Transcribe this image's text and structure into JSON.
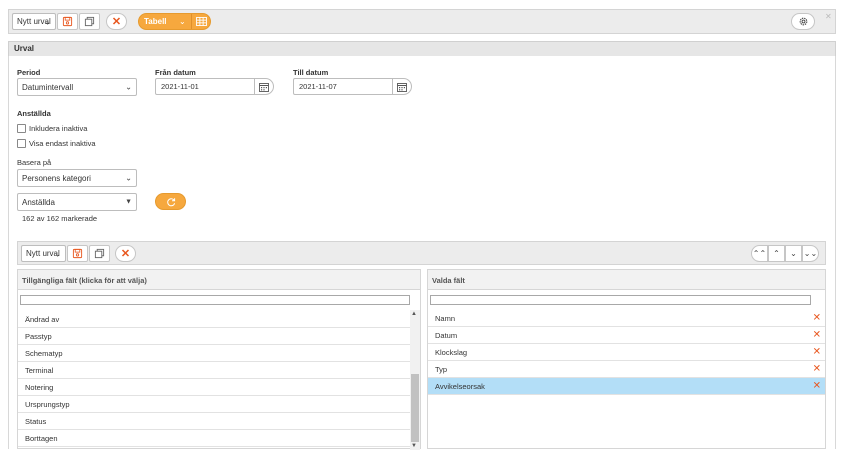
{
  "toolbar": {
    "selection_value": "Nytt urval",
    "view_value": "Tabell"
  },
  "urval": {
    "title": "Urval",
    "period_label": "Period",
    "period_value": "Datumintervall",
    "from_label": "Från datum",
    "from_value": "2021-11-01",
    "to_label": "Till datum",
    "to_value": "2021-11-07",
    "employees_label": "Anställda",
    "include_inactive": "Inkludera inaktiva",
    "show_only_inactive": "Visa endast inaktiva",
    "base_label": "Basera på",
    "base_value": "Personens kategori",
    "employees_select": "Anställda",
    "marked_count": "162 av 162 markerade"
  },
  "fields_toolbar": {
    "selection_value": "Nytt urval"
  },
  "available": {
    "header": "Tillgängliga fält (klicka för att välja)",
    "items": [
      "Ändrad av",
      "Passtyp",
      "Schematyp",
      "Terminal",
      "Notering",
      "Ursprungstyp",
      "Status",
      "Borttagen"
    ]
  },
  "selected": {
    "header": "Valda fält",
    "items": [
      "Namn",
      "Datum",
      "Klockslag",
      "Typ",
      "Avvikelseorsak"
    ]
  },
  "colors": {
    "accent": "#f6a83e",
    "remove": "#e8571f",
    "row_selected": "#b3def7"
  }
}
